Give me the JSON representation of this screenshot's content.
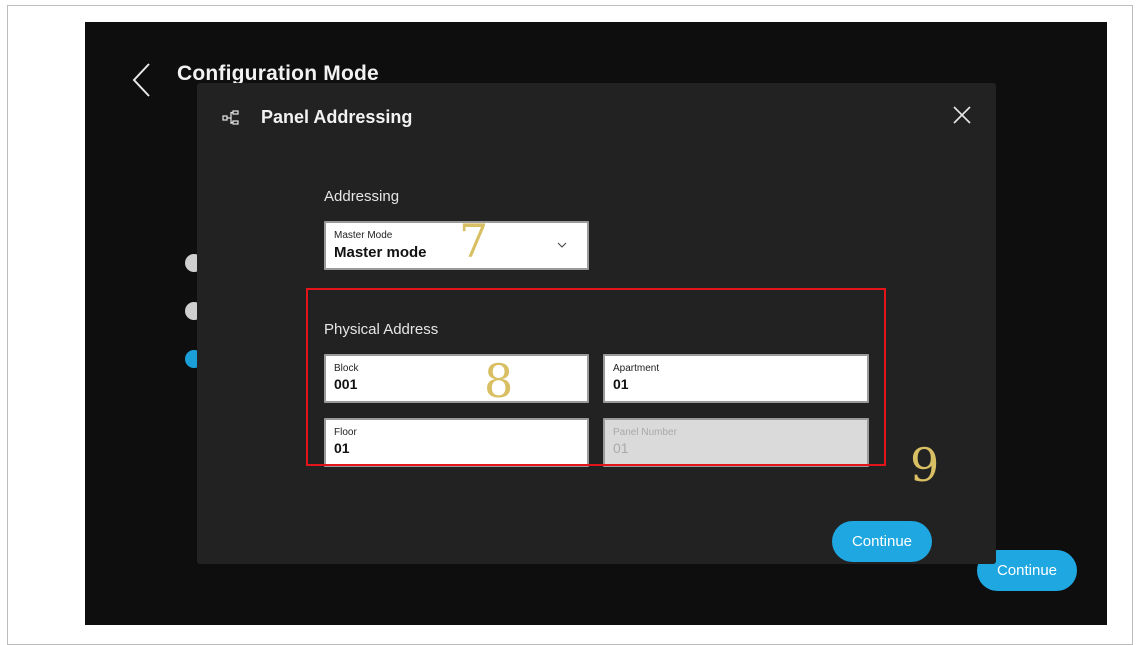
{
  "background": {
    "title": "Configuration Mode",
    "continue_label": "Continue"
  },
  "dialog": {
    "title": "Panel Addressing",
    "addressing_label": "Addressing",
    "master_mode": {
      "label": "Master Mode",
      "value": "Master mode"
    },
    "physical_address_label": "Physical Address",
    "block": {
      "label": "Block",
      "value": "001"
    },
    "apartment": {
      "label": "Apartment",
      "value": "01"
    },
    "floor": {
      "label": "Floor",
      "value": "01"
    },
    "panel_number": {
      "label": "Panel Number",
      "value": "01"
    },
    "continue_label": "Continue"
  },
  "annotations": {
    "n7": "7",
    "n8": "8",
    "n9": "9"
  },
  "colors": {
    "accent": "#1ea7e1",
    "highlight_box": "#e3141a",
    "annotation": "#d8bf63",
    "dialog_bg": "#222222",
    "screen_bg": "#0e0e0e"
  },
  "icons": {
    "back": "chevron-left-icon",
    "panel": "network-tree-icon",
    "close": "close-icon",
    "dropdown": "chevron-down-icon"
  }
}
